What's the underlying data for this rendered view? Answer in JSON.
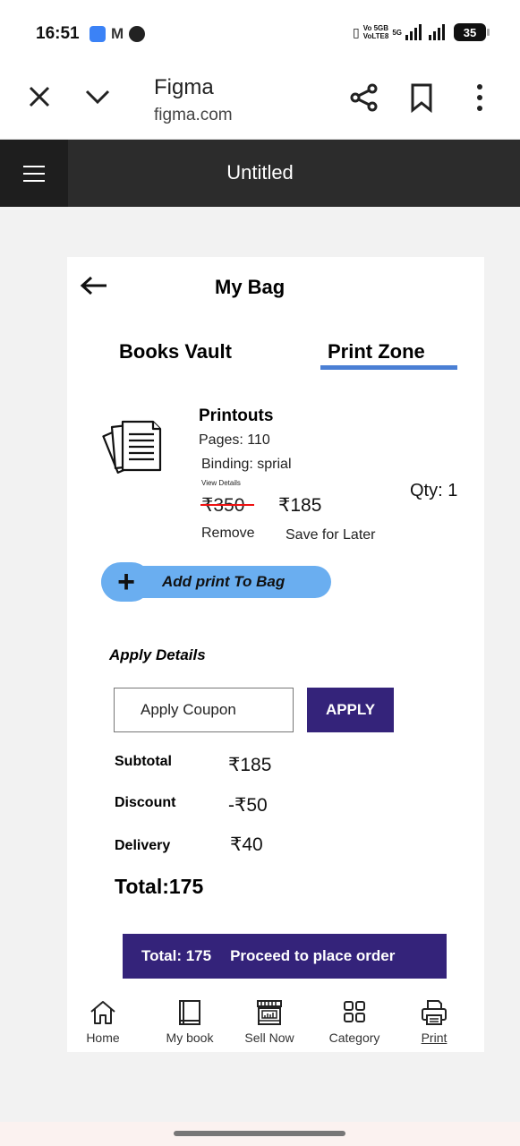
{
  "status_bar": {
    "time": "16:51",
    "network_line1": "Vo 5GB",
    "network_line2": "VoLTE8",
    "network_5g": "5G",
    "battery": "35"
  },
  "browser": {
    "title": "Figma",
    "url": "figma.com",
    "icons": [
      "close-icon",
      "chevron-down-icon",
      "share-icon",
      "bookmark-icon",
      "more-vertical-icon"
    ]
  },
  "figma": {
    "document_title": "Untitled"
  },
  "page": {
    "title": "My Bag",
    "tabs": [
      {
        "label": "Books Vault",
        "active": false
      },
      {
        "label": "Print Zone",
        "active": true
      }
    ],
    "accent_color": "#4a7fd4"
  },
  "cart_item": {
    "name": "Printouts",
    "pages": "Pages: 110",
    "binding": "Binding: sprial",
    "view_details": "View Details",
    "original_price": "₹350",
    "price": "₹185",
    "quantity": "Qty: 1",
    "remove_label": "Remove",
    "save_later_label": "Save for Later"
  },
  "add_print": {
    "plus": "+",
    "label": "Add print To Bag",
    "color": "#6aaef0"
  },
  "apply_section": {
    "heading": "Apply Details",
    "coupon_placeholder": "Apply Coupon",
    "apply_label": "APPLY",
    "button_color": "#34237a"
  },
  "summary": {
    "subtotal_label": "Subtotal",
    "subtotal_value": "₹185",
    "discount_label": "Discount",
    "discount_value": "-₹50",
    "delivery_label": "Delivery",
    "delivery_value": "₹40",
    "total": "Total:175"
  },
  "proceed": {
    "total": "Total: 175",
    "label": "Proceed to place order"
  },
  "bottom_nav": {
    "items": [
      {
        "label": "Home",
        "icon": "home-icon",
        "active": false
      },
      {
        "label": "My book",
        "icon": "book-icon",
        "active": false
      },
      {
        "label": "Sell Now",
        "icon": "store-icon",
        "active": false
      },
      {
        "label": "Category",
        "icon": "category-grid-icon",
        "active": false
      },
      {
        "label": "Print",
        "icon": "printer-icon",
        "active": true
      }
    ]
  }
}
